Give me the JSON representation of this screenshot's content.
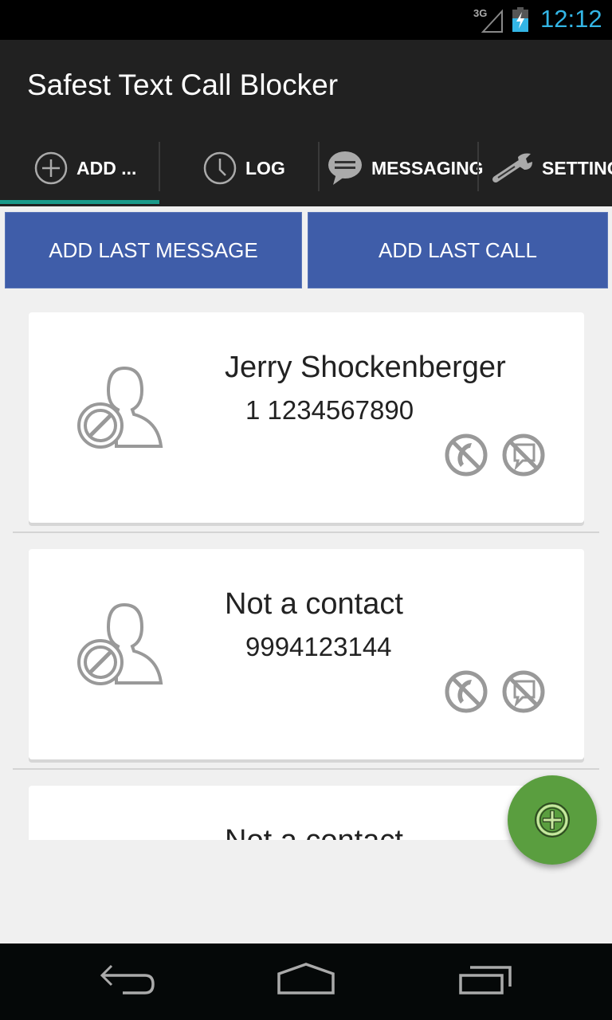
{
  "status_bar": {
    "network": "3G",
    "time": "12:12",
    "time_color": "#33b5e5",
    "icons": [
      "signal-3g-icon",
      "battery-charging-icon"
    ]
  },
  "action_bar": {
    "title": "Safest Text Call Blocker"
  },
  "tabs": [
    {
      "label": "ADD ...",
      "icon": "add-circle-icon",
      "selected": true
    },
    {
      "label": "LOG",
      "icon": "clock-icon",
      "selected": false
    },
    {
      "label": "MESSAGING",
      "icon": "chat-bubble-icon",
      "selected": false
    },
    {
      "label": "SETTINGS",
      "icon": "wrench-icon",
      "selected": false
    }
  ],
  "tab_indicator_color": "#1a9a8a",
  "buttons": {
    "add_last_message": "ADD LAST MESSAGE",
    "add_last_call": "ADD LAST CALL",
    "color": "#3f5da9"
  },
  "blocked_list": [
    {
      "name": "Jerry Shockenberger",
      "number": "1 1234567890",
      "call_blocked": true,
      "message_blocked": true
    },
    {
      "name": "Not a contact",
      "number": "9994123144",
      "call_blocked": true,
      "message_blocked": true
    },
    {
      "name": "Not a contact",
      "number": "",
      "call_blocked": true,
      "message_blocked": true
    }
  ],
  "fab": {
    "icon": "add-circle-icon",
    "color": "#5a9e3f"
  },
  "nav_bar": {
    "icons": [
      "back-icon",
      "home-icon",
      "recent-apps-icon"
    ]
  }
}
